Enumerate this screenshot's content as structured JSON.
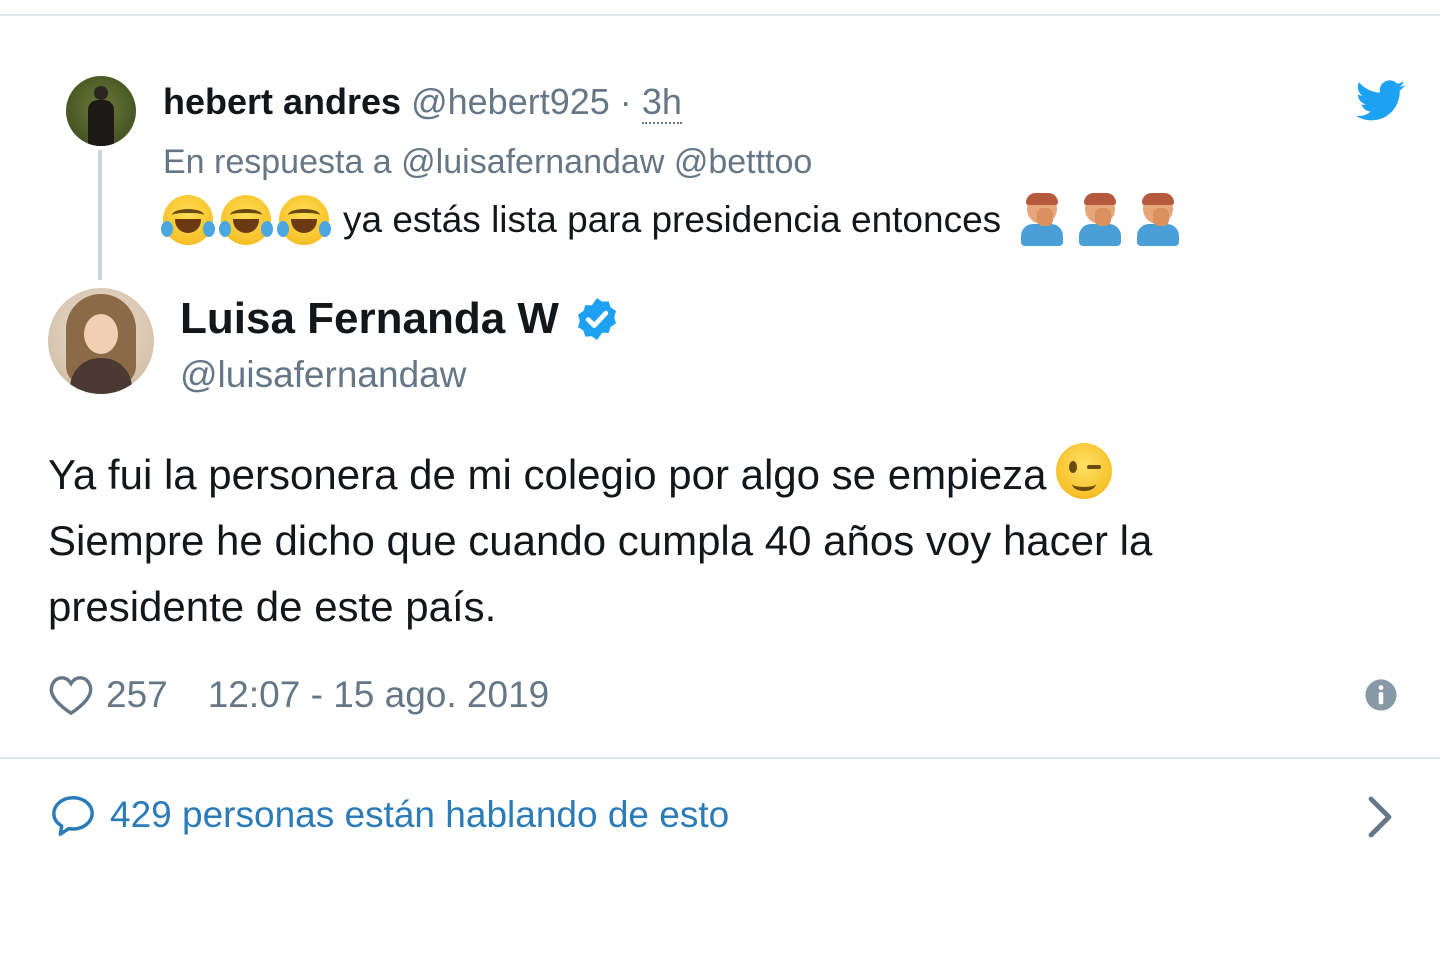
{
  "parent_tweet": {
    "name": "hebert andres",
    "handle": "@hebert925",
    "separator": "·",
    "time": "3h",
    "reply_prefix": "En respuesta a",
    "reply_mentions": [
      "@luisafernandaw",
      "@betttoo"
    ],
    "text": "ya estás lista para presidencia entonces",
    "leading_emoji": [
      "face-with-tears-of-joy",
      "face-with-tears-of-joy",
      "face-with-tears-of-joy"
    ],
    "trailing_emoji": [
      "man-facepalming",
      "man-facepalming",
      "man-facepalming"
    ]
  },
  "main_tweet": {
    "name": "Luisa Fernanda W",
    "handle": "@luisafernandaw",
    "verified": true,
    "text_lines": [
      "Ya fui la personera de mi colegio por algo se empieza",
      "Siempre he dicho que cuando cumpla 40 años voy hacer la",
      "presidente de este país."
    ],
    "inline_emoji": "winking-face",
    "likes": "257",
    "timestamp": "12:07 - 15 ago. 2019"
  },
  "conversation": {
    "label": "429 personas están hablando de esto"
  },
  "icons": {
    "brand": "twitter-bird-icon",
    "verified": "verified-badge-icon",
    "like": "heart-icon",
    "info": "info-icon",
    "comment": "comment-icon",
    "chevron": "chevron-right-icon"
  },
  "colors": {
    "twitter_blue": "#1da1f2",
    "link_blue": "#2b7bb9",
    "text_primary": "#14171a",
    "text_secondary": "#657786",
    "divider": "#e1e8ed"
  }
}
